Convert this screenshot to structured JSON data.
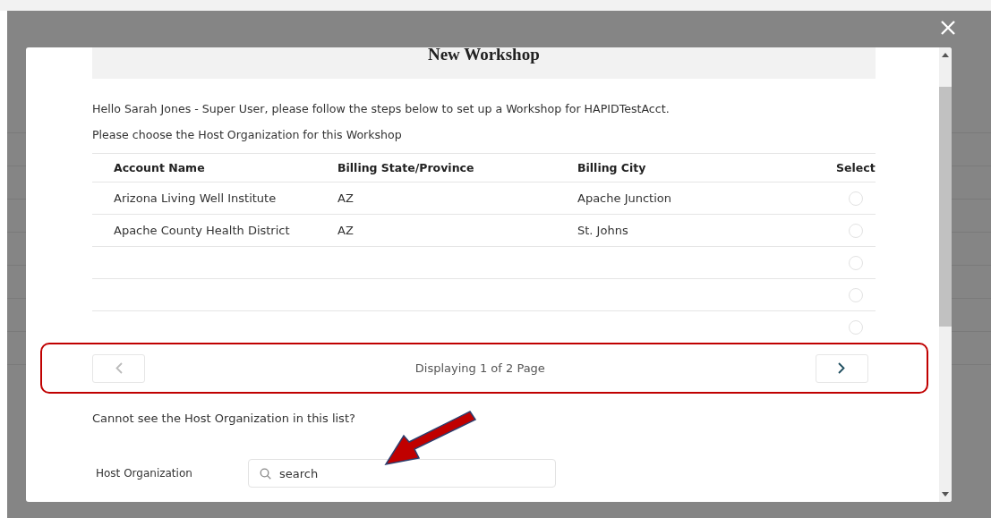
{
  "dialog": {
    "title": "New Workshop",
    "greeting": "Hello Sarah Jones - Super User, please follow the steps below to set up a Workshop for HAPIDTestAcct.",
    "instruction": "Please choose the Host Organization for this Workshop"
  },
  "table": {
    "columns": [
      "Account Name",
      "Billing State/Province",
      "Billing City",
      "Select"
    ],
    "rows": [
      {
        "cells": [
          "Arizona Living Well Institute",
          "AZ",
          "Apache Junction"
        ],
        "selected": false
      },
      {
        "cells": [
          "Apache County Health District",
          "AZ",
          "St. Johns"
        ],
        "selected": false
      },
      {
        "cells": [],
        "selected": false
      },
      {
        "cells": [],
        "selected": false
      },
      {
        "cells": [],
        "selected": false
      }
    ]
  },
  "pagination": {
    "prev_disabled": true,
    "next_disabled": false,
    "text": "Displaying 1 of 2 Page",
    "highlighted": true
  },
  "missing_prompt": "Cannot see the Host Organization in this list?",
  "host_field": {
    "label": "Host Organization",
    "placeholder": "search"
  },
  "annotation_arrow": true
}
